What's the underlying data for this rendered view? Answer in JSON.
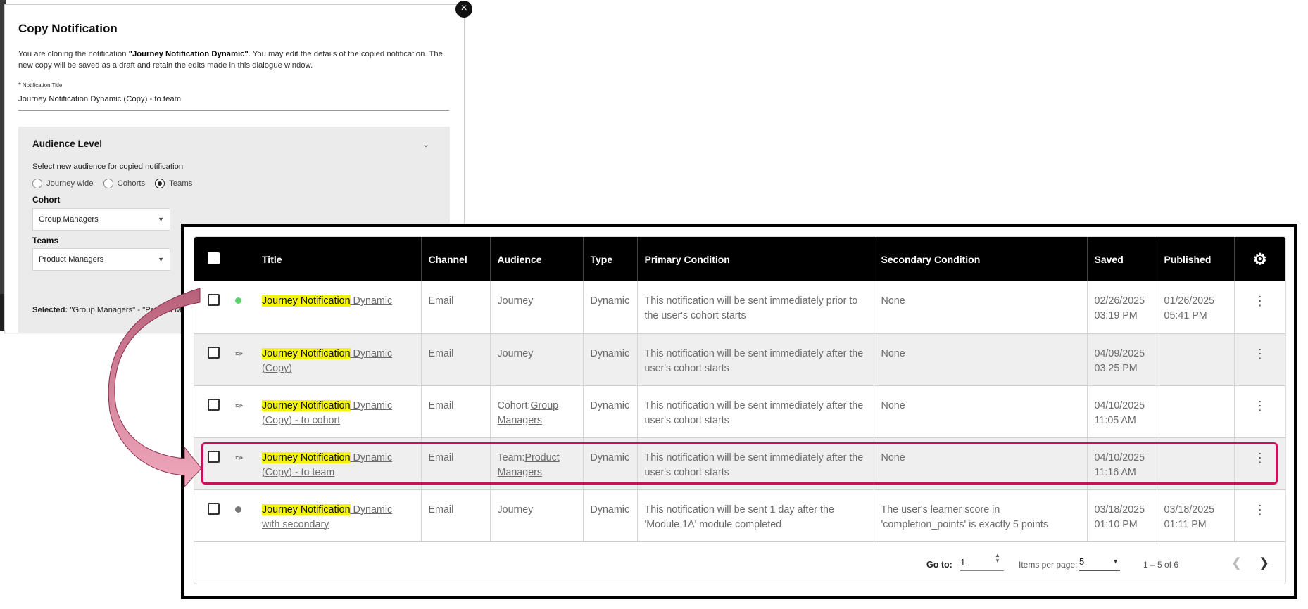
{
  "dialog": {
    "close_icon": "×",
    "title": "Copy Notification",
    "desc_prefix": "You are cloning the notification ",
    "desc_name": "\"Journey Notification Dynamic\"",
    "desc_suffix": ". You may edit the details of the copied notification. The new copy will be saved as a draft and retain the edits made in this dialogue window.",
    "field_required_mark": "*",
    "field_label": "Notification Title",
    "field_value": "Journey Notification Dynamic (Copy) - to team",
    "panel_title": "Audience Level",
    "panel_sub": "Select new audience for copied notification",
    "radios": [
      {
        "label": "Journey wide",
        "checked": false
      },
      {
        "label": "Cohorts",
        "checked": false
      },
      {
        "label": "Teams",
        "checked": true
      }
    ],
    "cohort_label": "Cohort",
    "cohort_value": "Group Managers",
    "teams_label": "Teams",
    "teams_value": "Product Managers",
    "selected_label": "Selected:",
    "selected_value": " \"Group Managers\" - \"Product M"
  },
  "table": {
    "columns": [
      "Title",
      "Channel",
      "Audience",
      "Type",
      "Primary Condition",
      "Secondary Condition",
      "Saved",
      "Published"
    ],
    "rows": [
      {
        "status": "active",
        "title_hl": "Journey Notification",
        "title_rest": " Dynamic",
        "title_line2": "",
        "channel": "Email",
        "aud_prefix": "Journey",
        "aud_link": "",
        "aud_link2": "",
        "type": "Dynamic",
        "primary": "This notification will be sent immediately prior to the user's cohort starts",
        "secondary": "None",
        "saved_date": "02/26/2025",
        "saved_time": "03:19 PM",
        "pub_date": "01/26/2025",
        "pub_time": "05:41 PM"
      },
      {
        "status": "draft",
        "title_hl": "Journey Notification",
        "title_rest": " Dynamic",
        "title_line2": "(Copy)",
        "channel": "Email",
        "aud_prefix": "Journey",
        "aud_link": "",
        "aud_link2": "",
        "type": "Dynamic",
        "primary": "This notification will be sent immediately after the user's cohort starts",
        "secondary": "None",
        "saved_date": "04/09/2025",
        "saved_time": "03:25 PM",
        "pub_date": "",
        "pub_time": ""
      },
      {
        "status": "draft",
        "title_hl": "Journey Notification",
        "title_rest": " Dynamic",
        "title_line2": "(Copy) - to cohort",
        "channel": "Email",
        "aud_prefix": "Cohort:",
        "aud_link": "Group",
        "aud_link2": "Managers",
        "type": "Dynamic",
        "primary": "This notification will be sent immediately after the user's cohort starts",
        "secondary": "None",
        "saved_date": "04/10/2025",
        "saved_time": "11:05 AM",
        "pub_date": "",
        "pub_time": ""
      },
      {
        "status": "draft",
        "title_hl": "Journey Notification",
        "title_rest": " Dynamic",
        "title_line2": "(Copy) - to team",
        "channel": "Email",
        "aud_prefix": "Team:",
        "aud_link": "Product",
        "aud_link2": "Managers",
        "type": "Dynamic",
        "primary": "This notification will be sent immediately after the user's cohort starts",
        "secondary": "None",
        "saved_date": "04/10/2025",
        "saved_time": "11:16 AM",
        "pub_date": "",
        "pub_time": ""
      },
      {
        "status": "inactive",
        "title_hl": "Journey Notification",
        "title_rest": " Dynamic",
        "title_line2": "with secondary",
        "channel": "Email",
        "aud_prefix": "Journey",
        "aud_link": "",
        "aud_link2": "",
        "type": "Dynamic",
        "primary": "This notification will be sent 1 day after the 'Module 1A' module completed",
        "secondary": "The user's learner score in 'completion_points' is exactly 5 points",
        "saved_date": "03/18/2025",
        "saved_time": "01:10 PM",
        "pub_date": "03/18/2025",
        "pub_time": "01:11 PM"
      }
    ],
    "highlighted_row_index": 3
  },
  "paginator": {
    "goto_label": "Go to:",
    "goto_value": "1",
    "items_label": "Items per page:",
    "items_value": "5",
    "range_text": "1 – 5 of 6"
  },
  "colors": {
    "highlight": "#f4f40a",
    "row_outline": "#c4135c",
    "arrow": "#e0809c",
    "status_active": "#5ad46a"
  }
}
